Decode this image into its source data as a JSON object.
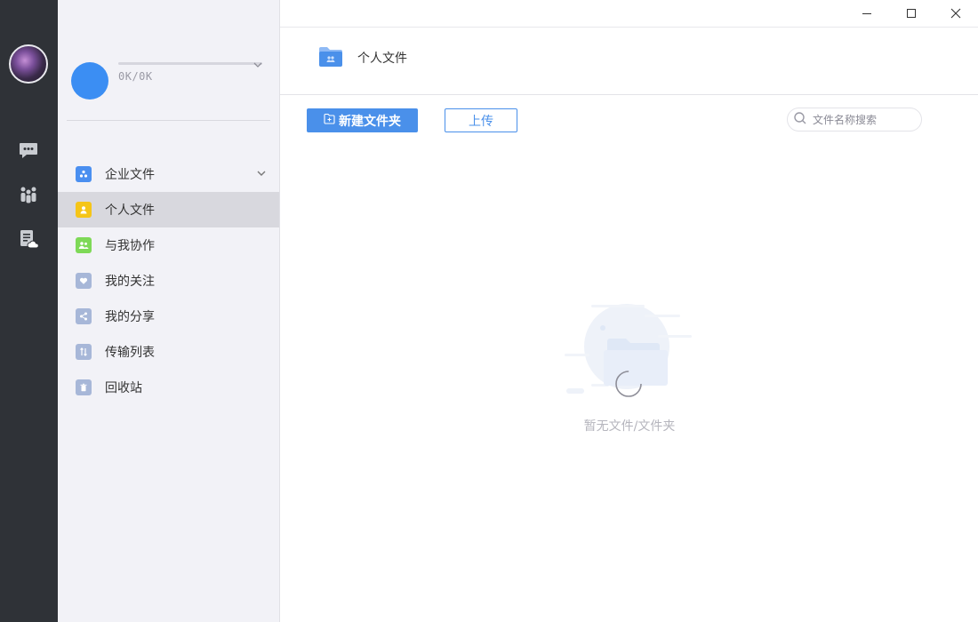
{
  "quota": {
    "text": "0K/0K"
  },
  "sidebar": {
    "items": [
      {
        "label": "企业文件",
        "icon": "enterprise-files-icon",
        "color": "#4a8ff0",
        "expandable": true
      },
      {
        "label": "个人文件",
        "icon": "personal-files-icon",
        "color": "#f5c518",
        "active": true
      },
      {
        "label": "与我协作",
        "icon": "collaboration-icon",
        "color": "#7ed957"
      },
      {
        "label": "我的关注",
        "icon": "heart-icon",
        "color": "#a7b7d8"
      },
      {
        "label": "我的分享",
        "icon": "share-icon",
        "color": "#a7b7d8"
      },
      {
        "label": "传输列表",
        "icon": "transfer-icon",
        "color": "#a7b7d8"
      },
      {
        "label": "回收站",
        "icon": "trash-icon",
        "color": "#a7b7d8"
      }
    ]
  },
  "main": {
    "title": "个人文件",
    "new_folder_label": "新建文件夹",
    "upload_label": "上传",
    "search_placeholder": "文件名称搜索",
    "empty_text": "暂无文件/文件夹"
  },
  "colors": {
    "accent": "#4a90ea",
    "rail": "#2f3237",
    "sidebar_bg": "#f2f2f7"
  }
}
